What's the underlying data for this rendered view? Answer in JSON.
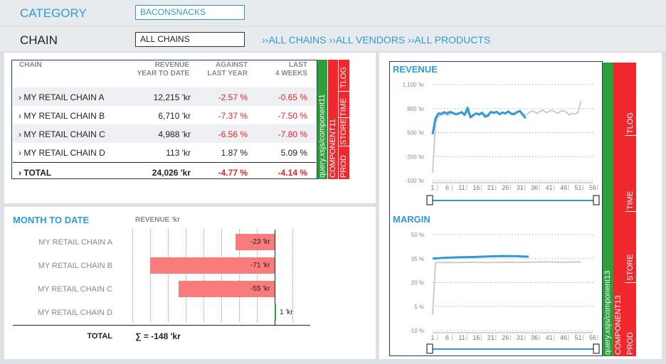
{
  "filters": {
    "category_label": "CATEGORY",
    "category_value": "BACONSNACKS",
    "chain_label": "CHAIN",
    "chain_value": "ALL CHAINS",
    "breadcrumb": "››ALL CHAINS ››ALL VENDORS ››ALL PRODUCTS"
  },
  "colors": {
    "accent": "#2f9bd6",
    "negative": "#e0242a",
    "bar": "#fa7b7b",
    "green_tab": "#2e9e3a",
    "red_tab": "#f0282d"
  },
  "table": {
    "headers": [
      {
        "line1": "CHAIN",
        "line2": ""
      },
      {
        "line1": "REVENUE",
        "line2": "YEAR TO DATE"
      },
      {
        "line1": "AGAINST",
        "line2": "LAST YEAR"
      },
      {
        "line1": "LAST",
        "line2": "4 WEEKS"
      }
    ],
    "rows": [
      {
        "name": "› MY RETAIL CHAIN A",
        "revenue": "12,215 'kr",
        "vs_ly": "-2.57 %",
        "last4": "-0.65 %"
      },
      {
        "name": "› MY RETAIL CHAIN B",
        "revenue": "6,710 'kr",
        "vs_ly": "-7.37 %",
        "last4": "-7.50 %"
      },
      {
        "name": "› MY RETAIL CHAIN C",
        "revenue": "4,988 'kr",
        "vs_ly": "-6.56 %",
        "last4": "-7.80 %"
      },
      {
        "name": "› MY RETAIL CHAIN D",
        "revenue": "113 'kr",
        "vs_ly": "1.87 %",
        "last4": "5.09 %"
      }
    ],
    "total": {
      "name": "› TOTAL",
      "revenue": "24,026 'kr",
      "vs_ly": "-4.77 %",
      "last4": "-4.14 %"
    },
    "tabs": {
      "query": "query.xsjs/component11",
      "component": "COMPONENT11",
      "prod": "PROD",
      "store": "STORE",
      "time": "TIME",
      "tlog": "TLOG"
    }
  },
  "mtd": {
    "title": "MONTH TO DATE",
    "subtitle": "REVENUE 'kr",
    "items": [
      {
        "name": "MY RETAIL CHAIN A",
        "value": -23,
        "label": "-23 'kr"
      },
      {
        "name": "MY RETAIL CHAIN B",
        "value": -71,
        "label": "-71 'kr"
      },
      {
        "name": "MY RETAIL CHAIN C",
        "value": -55,
        "label": "-55 'kr"
      },
      {
        "name": "MY RETAIL CHAIN D",
        "value": 1,
        "label": "1 'kr"
      }
    ],
    "total_label": "TOTAL",
    "total_value": "∑ = -148 'kr"
  },
  "charts_tabs": {
    "query": "query.xsjs/component13",
    "component": "COMPONENT13",
    "prod": "PROD",
    "store": "STORE",
    "time": "TIME",
    "tlog": "TLOG"
  },
  "chart_data": [
    {
      "type": "line",
      "title": "REVENUE",
      "y_ticks": [
        "1,100 'kr",
        "800 'kr",
        "500 'kr",
        "200 'kr",
        "-100 'kr"
      ],
      "ylim": [
        -100,
        1100
      ],
      "x_ticks": [
        "1",
        "6",
        "11",
        "16",
        "21",
        "26",
        "31",
        "36",
        "41",
        "46",
        "51",
        "56"
      ],
      "xlim": [
        1,
        56
      ],
      "series": [
        {
          "role": "current",
          "color": "#2f9bd6",
          "points": [
            [
              1,
              480
            ],
            [
              2,
              680
            ],
            [
              3,
              740
            ],
            [
              4,
              735
            ],
            [
              5,
              755
            ],
            [
              6,
              740
            ],
            [
              7,
              760
            ],
            [
              8,
              745
            ],
            [
              9,
              730
            ],
            [
              10,
              740
            ],
            [
              11,
              755
            ],
            [
              12,
              720
            ],
            [
              13,
              810
            ],
            [
              14,
              690
            ],
            [
              15,
              720
            ],
            [
              16,
              740
            ],
            [
              17,
              725
            ],
            [
              18,
              750
            ],
            [
              19,
              700
            ],
            [
              20,
              710
            ],
            [
              21,
              760
            ],
            [
              22,
              745
            ],
            [
              23,
              760
            ],
            [
              24,
              730
            ],
            [
              25,
              750
            ],
            [
              26,
              740
            ],
            [
              27,
              765
            ],
            [
              28,
              735
            ],
            [
              29,
              730
            ],
            [
              30,
              755
            ],
            [
              31,
              770
            ],
            [
              32,
              720
            ],
            [
              33,
              680
            ]
          ]
        },
        {
          "role": "last_year",
          "color": "#cccccc",
          "points": [
            [
              1,
              0
            ],
            [
              2,
              620
            ],
            [
              3,
              700
            ],
            [
              4,
              720
            ],
            [
              5,
              730
            ],
            [
              6,
              715
            ],
            [
              7,
              730
            ],
            [
              8,
              740
            ],
            [
              9,
              720
            ],
            [
              10,
              735
            ],
            [
              11,
              745
            ],
            [
              12,
              730
            ],
            [
              13,
              760
            ],
            [
              14,
              700
            ],
            [
              15,
              720
            ],
            [
              16,
              735
            ],
            [
              17,
              740
            ],
            [
              18,
              745
            ],
            [
              19,
              725
            ],
            [
              20,
              730
            ],
            [
              21,
              760
            ],
            [
              22,
              745
            ],
            [
              23,
              755
            ],
            [
              24,
              740
            ],
            [
              25,
              750
            ],
            [
              26,
              740
            ],
            [
              27,
              760
            ],
            [
              28,
              745
            ],
            [
              29,
              740
            ],
            [
              30,
              760
            ],
            [
              31,
              770
            ],
            [
              32,
              740
            ],
            [
              33,
              720
            ],
            [
              34,
              745
            ],
            [
              35,
              770
            ],
            [
              36,
              760
            ],
            [
              37,
              740
            ],
            [
              38,
              770
            ],
            [
              39,
              780
            ],
            [
              40,
              750
            ],
            [
              41,
              765
            ],
            [
              42,
              780
            ],
            [
              43,
              760
            ],
            [
              44,
              740
            ],
            [
              45,
              770
            ],
            [
              46,
              775
            ],
            [
              47,
              755
            ],
            [
              48,
              720
            ],
            [
              49,
              740
            ],
            [
              50,
              730
            ],
            [
              51,
              760
            ],
            [
              52,
              900
            ]
          ]
        }
      ]
    },
    {
      "type": "line",
      "title": "MARGIN",
      "y_ticks": [
        "50 %",
        "35 %",
        "20 %",
        "5 %",
        "-10 %"
      ],
      "ylim": [
        -10,
        50
      ],
      "x_ticks": [
        "1",
        "6",
        "11",
        "16",
        "21",
        "26",
        "31",
        "36",
        "41",
        "46",
        "51",
        "56"
      ],
      "xlim": [
        1,
        56
      ],
      "series": [
        {
          "role": "current",
          "color": "#2f9bd6",
          "points": [
            [
              1,
              35
            ],
            [
              5,
              35.5
            ],
            [
              10,
              35.8
            ],
            [
              15,
              36
            ],
            [
              20,
              36.3
            ],
            [
              25,
              36.6
            ],
            [
              30,
              36.5
            ],
            [
              34,
              36.2
            ]
          ]
        },
        {
          "role": "last_year",
          "color": "#cccccc",
          "points": [
            [
              1,
              0
            ],
            [
              2,
              32.5
            ],
            [
              5,
              32.6
            ],
            [
              10,
              32.5
            ],
            [
              15,
              32.8
            ],
            [
              20,
              32.5
            ],
            [
              25,
              32.7
            ],
            [
              30,
              32.6
            ],
            [
              35,
              32.8
            ],
            [
              40,
              33
            ],
            [
              45,
              32.7
            ],
            [
              50,
              32.9
            ],
            [
              52,
              33
            ]
          ]
        }
      ]
    }
  ]
}
